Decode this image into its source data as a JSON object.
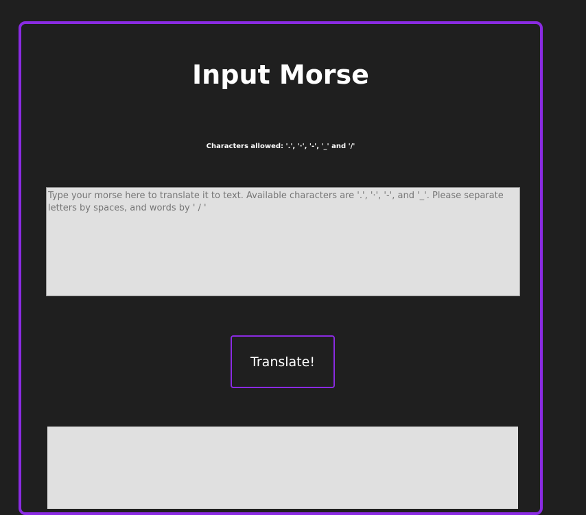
{
  "page": {
    "title": "Input Morse",
    "hint": "Characters allowed: '.', '·', '-', '_' and '/'"
  },
  "input": {
    "placeholder": "Type your morse here to translate it to text. Available characters are '.', '·', '-', and '_'. Please separate letters by spaces, and words by ' / '",
    "value": ""
  },
  "actions": {
    "translate_label": "Translate!"
  },
  "output": {
    "value": ""
  },
  "colors": {
    "background": "#1f1f1f",
    "accent": "#8a2be2",
    "field": "#e0e0e0",
    "text": "#ffffff"
  }
}
